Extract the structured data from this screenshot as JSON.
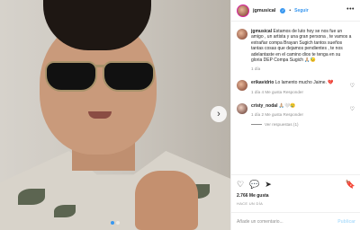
{
  "post": {
    "username": "jgmusical",
    "follow_label": "Seguir",
    "more_label": "•••",
    "caption": "Estamos de luto hoy se nos fue un amigo , un artista y una gran persona , te vamos a extrañar compa Brayan Sugich tantos sueños tantas cosas que dejamos pendientes , te nos adelantaste en el camino dios te tenga en su gloria DEP Compa Sugich 🙏🏼😓",
    "caption_time": "1 día",
    "likes": "2.766 Me gusta",
    "date": "HACE UN DÍA",
    "comment_placeholder": "Añade un comentario...",
    "publish_label": "Publicar"
  },
  "comments": [
    {
      "username": "erikavidrio",
      "text": "Lo lamento mucho Jaime. 💔",
      "meta": "1 día   4 Me gusta   Responder"
    },
    {
      "username": "cristy_nodal",
      "text": "🙏🏼🤍😢",
      "meta": "1 día   2 Me gusta   Responder"
    }
  ],
  "replies_label": "Ver respuestas (1)",
  "colors": {
    "accent": "#3897f0",
    "text": "#262626",
    "muted": "#8e8e8e"
  }
}
